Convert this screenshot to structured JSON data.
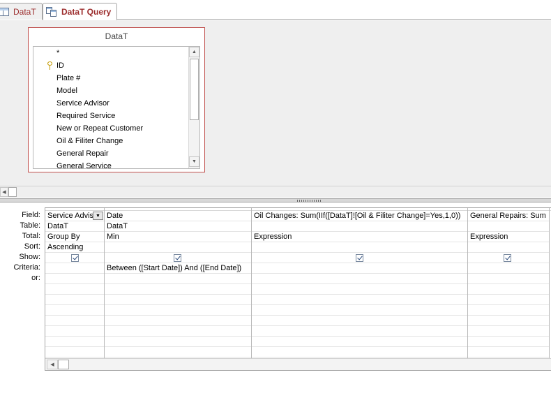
{
  "tabs": [
    {
      "label": "DataT",
      "icon": "table-icon",
      "active": false
    },
    {
      "label": "DataT Query",
      "icon": "query-icon",
      "active": true
    }
  ],
  "table_box": {
    "title": "DataT",
    "fields": [
      "*",
      "ID",
      "Plate #",
      "Model",
      "Service Advisor",
      "Required Service",
      "New or Repeat Customer",
      "Oil & Filiter Change",
      "General Repair",
      "General Service"
    ]
  },
  "grid": {
    "row_labels": [
      "Field:",
      "Table:",
      "Total:",
      "Sort:",
      "Show:",
      "Criteria:",
      "or:"
    ],
    "columns": [
      {
        "field": "Service Advis",
        "table": "DataT",
        "total": "Group By",
        "sort": "Ascending",
        "show": true,
        "criteria": "",
        "or": ""
      },
      {
        "field": "Date",
        "table": "DataT",
        "total": "Min",
        "sort": "",
        "show": true,
        "criteria": "Between ([Start Date]) And ([End Date])",
        "or": ""
      },
      {
        "field": "Oil Changes: Sum(IIf([DataT]![Oil & Filiter Change]=Yes,1,0))",
        "table": "",
        "total": "Expression",
        "sort": "",
        "show": true,
        "criteria": "",
        "or": ""
      },
      {
        "field": "General Repairs: Sum",
        "table": "",
        "total": "Expression",
        "sort": "",
        "show": true,
        "criteria": "",
        "or": ""
      }
    ]
  }
}
